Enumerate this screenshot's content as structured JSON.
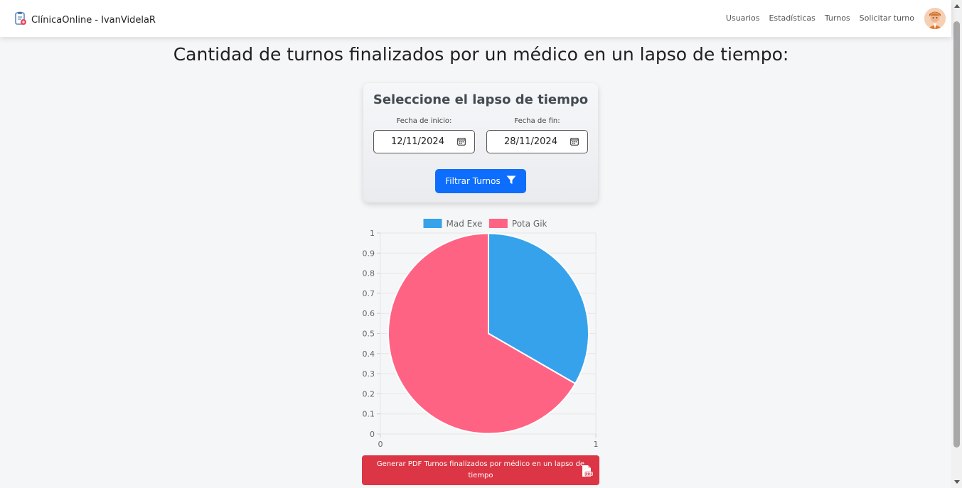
{
  "app": {
    "brand": "ClínicaOnline - IvanVidelaR"
  },
  "nav": {
    "items": [
      {
        "label": "Usuarios"
      },
      {
        "label": "Estadísticas"
      },
      {
        "label": "Turnos"
      },
      {
        "label": "Solicitar turno"
      }
    ]
  },
  "page": {
    "title": "Cantidad de turnos finalizados por un médico en un lapso de tiempo:"
  },
  "filter": {
    "title": "Seleccione el lapso de tiempo",
    "start_label": "Fecha de inicio:",
    "start_value": "12/11/2024",
    "end_label": "Fecha de fin:",
    "end_value": "28/11/2024",
    "button_label": "Filtrar Turnos"
  },
  "pdf_button": {
    "label": "Generar PDF Turnos finalizados por médico en un lapso de tiempo"
  },
  "colors": {
    "primary": "#0d6efd",
    "danger": "#dc3545",
    "series_blue": "#36a2eb",
    "series_red": "#ff6384"
  },
  "chart_data": {
    "type": "pie",
    "categories": [
      "Mad Exe",
      "Pota Gik"
    ],
    "values": [
      1,
      2
    ],
    "colors": [
      "#36a2eb",
      "#ff6384"
    ],
    "legend": "top",
    "grid": true,
    "y_ticks": [
      "1",
      "0.9",
      "0.8",
      "0.7",
      "0.6",
      "0.5",
      "0.4",
      "0.3",
      "0.2",
      "0.1",
      "0"
    ],
    "x_ticks": [
      "0",
      "1"
    ],
    "ylim": [
      0,
      1
    ],
    "xlim": [
      0,
      1
    ]
  }
}
